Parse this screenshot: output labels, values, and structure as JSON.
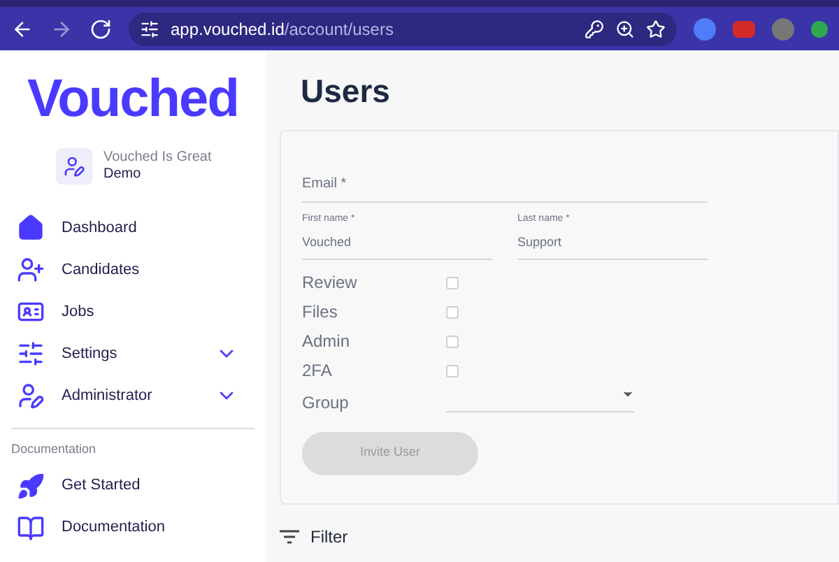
{
  "browser": {
    "url_host": "app.vouched.id",
    "url_path": "/account/users"
  },
  "sidebar": {
    "logo": "Vouched",
    "account": {
      "name": "Vouched Is Great",
      "role": "Demo"
    },
    "items": [
      {
        "label": "Dashboard",
        "kind": "dashboard"
      },
      {
        "label": "Candidates",
        "kind": "candidates"
      },
      {
        "label": "Jobs",
        "kind": "jobs"
      },
      {
        "label": "Settings",
        "kind": "settings",
        "expanded": false
      },
      {
        "label": "Administrator",
        "kind": "admin",
        "expanded": false
      }
    ],
    "section": "Documentation",
    "doc_items": [
      {
        "label": "Get Started",
        "kind": "rocket"
      },
      {
        "label": "Documentation",
        "kind": "book"
      }
    ]
  },
  "page": {
    "title": "Users",
    "form": {
      "email": {
        "label": "Email *"
      },
      "first_name": {
        "label": "First name *",
        "value": "Vouched"
      },
      "last_name": {
        "label": "Last name *",
        "value": "Support"
      },
      "permissions": [
        {
          "label": "Review",
          "checked": false
        },
        {
          "label": "Files",
          "checked": false
        },
        {
          "label": "Admin",
          "checked": false
        },
        {
          "label": "2FA",
          "checked": false
        }
      ],
      "group": {
        "label": "Group"
      },
      "submit": {
        "label": "Invite User",
        "disabled": true
      }
    },
    "filter": "Filter"
  }
}
